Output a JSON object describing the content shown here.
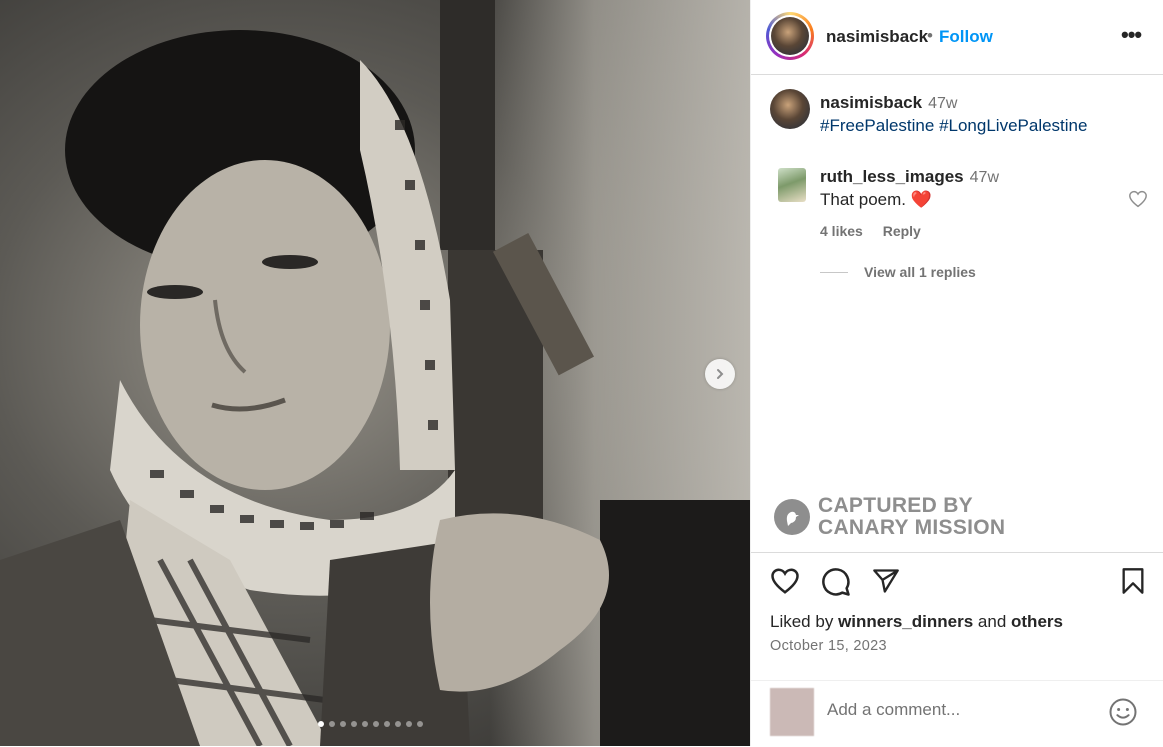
{
  "header": {
    "username": "nasimisback",
    "separator": "•",
    "follow_label": "Follow",
    "more_label": "•••"
  },
  "caption": {
    "username": "nasimisback",
    "time": "47w",
    "text": "#FreePalestine #LongLivePalestine"
  },
  "comment": {
    "username": "ruth_less_images",
    "time": "47w",
    "text": "That poem.",
    "emoji": "❤️",
    "likes": "4 likes",
    "reply_label": "Reply",
    "view_replies": "View all 1 replies"
  },
  "watermark": {
    "line1": "CAPTURED BY",
    "line2": "CANARY MISSION"
  },
  "likes": {
    "prefix": "Liked by",
    "user": "winners_dinners",
    "and": "and",
    "others": "others"
  },
  "date": "October 15, 2023",
  "add_comment": {
    "placeholder": "Add a comment..."
  },
  "carousel": {
    "slide_count": 10,
    "active_index": 0
  },
  "icons": {
    "like": "heart-icon",
    "comment": "comment-icon",
    "share": "share-icon",
    "save": "bookmark-icon",
    "emoji": "emoji-icon",
    "next": "chevron-right-icon"
  },
  "colors": {
    "link": "#0095f6",
    "hashtag": "#00376b",
    "muted": "#737373"
  }
}
